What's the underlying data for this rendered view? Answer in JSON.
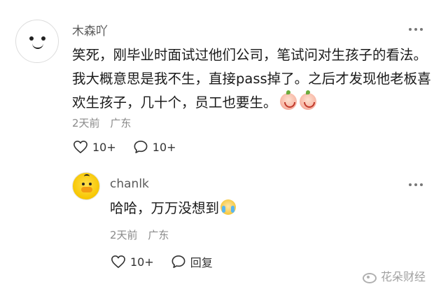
{
  "main_comment": {
    "username": "木森吖",
    "text": "笑死，刚毕业时面试过他们公司，笔试问对生孩子的看法。我大概意思是我不生，直接pass掉了。之后才发现他老板喜欢生孩子，几十个，员工也要生。",
    "time": "2天前",
    "location": "广东",
    "like_count": "10+",
    "comment_count": "10+",
    "avatar_icon": "smiley-face-avatar",
    "trailing_emojis": [
      "crying-laugh-emoji",
      "crying-laugh-emoji"
    ]
  },
  "reply": {
    "username": "chanlk",
    "text": "哈哈，万万没想到",
    "time": "2天前",
    "location": "广东",
    "like_count": "10+",
    "reply_label": "回复",
    "avatar_icon": "yellow-duck-avatar",
    "trailing_emoji": "crying-emoji"
  },
  "watermark": {
    "text": "花朵财经",
    "icon": "weibo-logo-icon"
  },
  "colors": {
    "text_primary": "#1a1a1a",
    "text_secondary": "#8a8a8a",
    "username": "#5a5a5a",
    "watermark": "#a0a0a0"
  }
}
